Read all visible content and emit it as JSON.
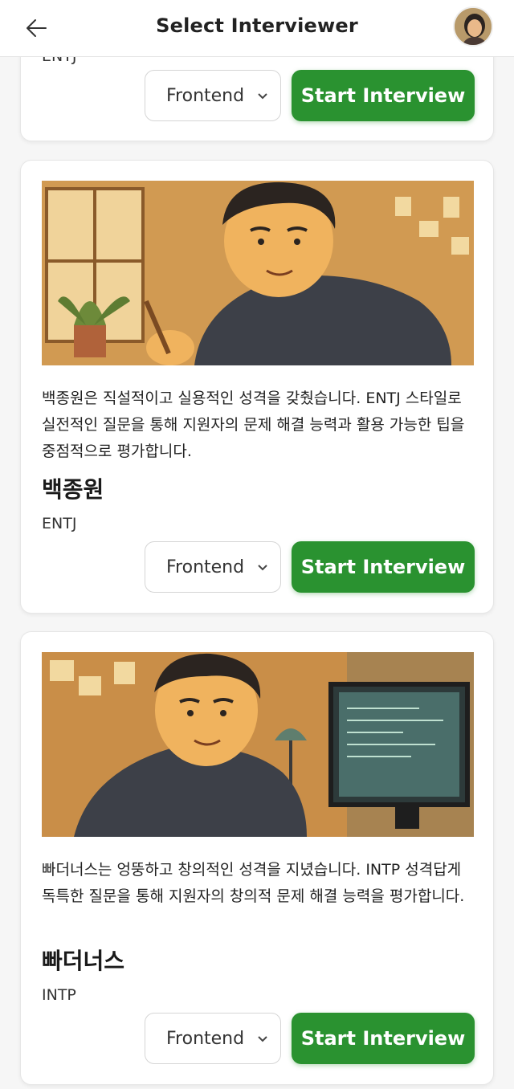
{
  "header": {
    "title": "Select Interviewer"
  },
  "cards": [
    {
      "mbti": "ENTJ",
      "select_value": "Frontend",
      "button_label": "Start Interview"
    },
    {
      "description": "백종원은 직설적이고 실용적인 성격을 갖췄습니다. ENTJ 스타일로 실전적인 질문을 통해 지원자의 문제 해결 능력과 활용 가능한 팁을 중점적으로 평가합니다.",
      "name": "백종원",
      "mbti": "ENTJ",
      "select_value": "Frontend",
      "button_label": "Start Interview"
    },
    {
      "description": "빠더너스는 엉뚱하고 창의적인 성격을 지녔습니다. INTP 성격답게 독특한 질문을 통해 지원자의 창의적 문제 해결 능력을 평가합니다.",
      "name": "빠더너스",
      "mbti": "INTP",
      "select_value": "Frontend",
      "button_label": "Start Interview"
    }
  ],
  "colors": {
    "primary_button": "#2a9230",
    "header_bg": "#ffffff",
    "page_bg": "#f6f6f6"
  },
  "icons": [
    "back-arrow-icon",
    "chevron-down-icon"
  ]
}
